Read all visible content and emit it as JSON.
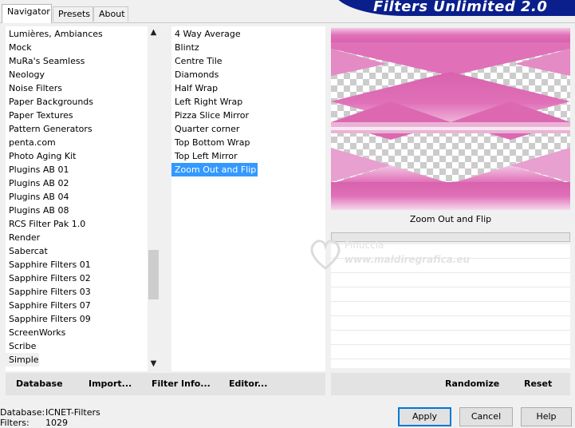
{
  "tabs": [
    "Navigator",
    "Presets",
    "About"
  ],
  "banner_title": "Filters Unlimited 2.0",
  "categories": [
    "Lumières, Ambiances",
    "Mock",
    "MuRa's Seamless",
    "Neology",
    "Noise Filters",
    "Paper Backgrounds",
    "Paper Textures",
    "Pattern Generators",
    "penta.com",
    "Photo Aging Kit",
    "Plugins AB 01",
    "Plugins AB 02",
    "Plugins AB 04",
    "Plugins AB 08",
    "RCS Filter Pak 1.0",
    "Render",
    "Sabercat",
    "Sapphire Filters 01",
    "Sapphire Filters 02",
    "Sapphire Filters 03",
    "Sapphire Filters 07",
    "Sapphire Filters 09",
    "ScreenWorks",
    "Scribe",
    "Simple"
  ],
  "filters": [
    "4 Way Average",
    "Blintz",
    "Centre Tile",
    "Diamonds",
    "Half Wrap",
    "Left Right Wrap",
    "Pizza Slice Mirror",
    "Quarter corner",
    "Top Bottom Wrap",
    "Top Left Mirror",
    "Zoom Out and Flip"
  ],
  "selected_filter": "Zoom Out and Flip",
  "selected_category": "Simple",
  "preview_caption": "Zoom Out and Flip",
  "watermark": {
    "name": "Pinuccia",
    "site": "www.maldiregrafica.eu"
  },
  "left_toolbar": {
    "database": "Database",
    "import": "Import...",
    "filter_info": "Filter Info...",
    "editor": "Editor..."
  },
  "right_toolbar": {
    "randomize": "Randomize",
    "reset": "Reset"
  },
  "status": {
    "database_label": "Database:",
    "database_value": "ICNET-Filters",
    "filters_label": "Filters:",
    "filters_value": "1029"
  },
  "buttons": {
    "apply": "Apply",
    "cancel": "Cancel",
    "help": "Help"
  },
  "colors": {
    "selection": "#3399ff",
    "banner": "#0a1f8c",
    "preview_pink": "#e070b8"
  }
}
